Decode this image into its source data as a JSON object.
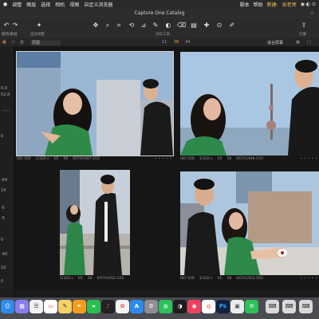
{
  "menubar": {
    "items": [
      "调整",
      "图层",
      "选择",
      "相机",
      "视图",
      "自定义浏览器"
    ],
    "right": [
      "脚本",
      "帮助"
    ],
    "user": "吴老师",
    "user_prefix": "新建:"
  },
  "window": {
    "title": "Capture One Catalog"
  },
  "toolbar": {
    "left_labels": [
      "撤销/重做",
      "自动调整"
    ],
    "center_label": "光标工具",
    "right_label": "已撤"
  },
  "strip": {
    "filter": "原图",
    "counts": [
      "11",
      "38",
      "34"
    ],
    "fit_label": "适合屏幕"
  },
  "sidebar": {
    "values": [
      "0.0",
      "52.8",
      "0",
      "-64",
      "14",
      "-5",
      "-5",
      "0",
      "-40",
      "10",
      "0"
    ]
  },
  "photos": [
    {
      "iso": "ISO 500",
      "shutter": "1/320 s",
      "aperture": "f/2",
      "focal": "58",
      "filename": "6X7A1947.CR2"
    },
    {
      "iso": "ISO 500",
      "shutter": "1/320 s",
      "aperture": "f/2",
      "focal": "58",
      "filename": "6X7A1949.CR2"
    },
    {
      "iso": "",
      "shutter": "1/320 s",
      "aperture": "f/2",
      "focal": "58",
      "filename": "6X7A1952.CR2"
    },
    {
      "iso": "ISO 500",
      "shutter": "1/320 s",
      "aperture": "f/2",
      "focal": "58",
      "filename": "6X7A1953.CR2"
    }
  ],
  "dock": {
    "apps": [
      "finder",
      "launchpad",
      "contacts",
      "calendar",
      "notes",
      "reminders",
      "pages",
      "maps",
      "wechat-like",
      "photos",
      "app-store",
      "settings",
      "wechat",
      "capture-one",
      "music",
      "photoshop",
      "preview",
      "messages",
      "keyboard",
      "keyboard2",
      "keyboard3"
    ]
  },
  "colors": {
    "accent": "#f0c25a",
    "selection": "#d0d0d0"
  }
}
